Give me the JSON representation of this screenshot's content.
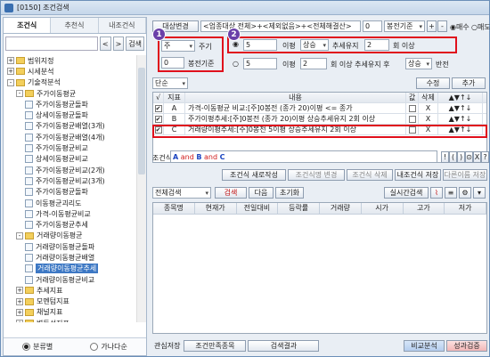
{
  "window": {
    "title": "[0150] 조건검색"
  },
  "left": {
    "tabs": [
      "조건식",
      "추천식",
      "내조건식"
    ],
    "search_btn": "검색",
    "tree": [
      {
        "label": "범위지정",
        "level": 0,
        "type": "folder",
        "exp": "+"
      },
      {
        "label": "시세분석",
        "level": 0,
        "type": "folder",
        "exp": "+"
      },
      {
        "label": "기술적분석",
        "level": 0,
        "type": "folder",
        "exp": "-"
      },
      {
        "label": "주가이동평균",
        "level": 1,
        "type": "folder",
        "exp": "-"
      },
      {
        "label": "주가이동평균돌파",
        "level": 2,
        "type": "leaf"
      },
      {
        "label": "상세이동평균돌파",
        "level": 2,
        "type": "leaf"
      },
      {
        "label": "주가이동평균배열(3개)",
        "level": 2,
        "type": "leaf"
      },
      {
        "label": "주가이동평균배열(4개)",
        "level": 2,
        "type": "leaf"
      },
      {
        "label": "주가이동평균비교",
        "level": 2,
        "type": "leaf"
      },
      {
        "label": "상세이동평균비교",
        "level": 2,
        "type": "leaf"
      },
      {
        "label": "주가이동평균비교(2개)",
        "level": 2,
        "type": "leaf"
      },
      {
        "label": "주가이동평균비교(3개)",
        "level": 2,
        "type": "leaf"
      },
      {
        "label": "주가이동평균돌파",
        "level": 2,
        "type": "leaf"
      },
      {
        "label": "이동평균괴리도",
        "level": 2,
        "type": "leaf"
      },
      {
        "label": "가격-이동평균비교",
        "level": 2,
        "type": "leaf"
      },
      {
        "label": "주가이동평균추세",
        "level": 2,
        "type": "leaf"
      },
      {
        "label": "거래량이동평균",
        "level": 1,
        "type": "folder",
        "exp": "-"
      },
      {
        "label": "거래량이동평균돌파",
        "level": 2,
        "type": "leaf"
      },
      {
        "label": "거래량이동평균배열",
        "level": 2,
        "type": "leaf"
      },
      {
        "label": "거래량이동평균추세",
        "level": 2,
        "type": "leaf",
        "selected": true
      },
      {
        "label": "거래량이동평균비교",
        "level": 2,
        "type": "leaf"
      },
      {
        "label": "추세지표",
        "level": 1,
        "type": "folder",
        "exp": "+"
      },
      {
        "label": "모멘텀지표",
        "level": 1,
        "type": "folder",
        "exp": "+"
      },
      {
        "label": "채널지표",
        "level": 1,
        "type": "folder",
        "exp": "+"
      },
      {
        "label": "변동성지표",
        "level": 1,
        "type": "folder",
        "exp": "+"
      },
      {
        "label": "기타지표",
        "level": 1,
        "type": "folder",
        "exp": "+"
      }
    ],
    "radio_a": "분류별",
    "radio_b": "가나다순"
  },
  "top": {
    "target": "대상변경",
    "scope": "<업종대상 전체>+<제외없음>+<전체해결산>",
    "bong": "0",
    "bong_label": "봉전기준",
    "buy": "매수",
    "sell": "매도"
  },
  "opt1": {
    "period": "주",
    "period_label": "주기",
    "bong": "0",
    "bong_label": "봉전기준"
  },
  "opt2": {
    "days": "5",
    "l1": "이평",
    "dir": "상승",
    "l2": "추세유지",
    "cnt": "2",
    "l3": "회 이상"
  },
  "opt3": {
    "days": "5",
    "l1": "이평",
    "n2": "2",
    "l2": "회 이상 추세유지 후",
    "dir": "상승",
    "l3": "반전"
  },
  "simple": "단순",
  "edit": "수정",
  "add": "추가",
  "grid": {
    "headers": [
      "√",
      "지표",
      "내용",
      "값",
      "삭제",
      "▲▼↑↓"
    ],
    "rows": [
      {
        "k": "A",
        "text": "가격-이동평균 비교:[주]0봉전 (종가 20)이평 <= 종가",
        "del": "X"
      },
      {
        "k": "B",
        "text": "주가이평추세:[주]0봉전 (종가 20)이평 상승추세유지 2회 이상",
        "del": "X"
      },
      {
        "k": "C",
        "text": "거래량이평추세:[주]0봉전 5이평 상승추세유지 2회 이상",
        "del": "X"
      }
    ]
  },
  "cond": {
    "label": "조건식",
    "expr_a": "A",
    "and1": "and",
    "expr_b": "B",
    "and2": "and",
    "expr_c": "C",
    "ops": [
      "!",
      "(",
      ")",
      "⊙",
      "X",
      "?"
    ]
  },
  "actions": {
    "a": "조건식 새로작성",
    "b": "조건식명 변경",
    "c": "조건식 삭제",
    "d": "내조건식 저장",
    "e": "다른이름 저장"
  },
  "search": {
    "scope": "전체검색",
    "btn": "검색",
    "next": "다음",
    "reset": "초기화",
    "realtime": "실시간검색"
  },
  "results": {
    "headers": [
      "종목명",
      "현재가",
      "전일대비",
      "등락률",
      "거래량",
      "시가",
      "고가",
      "저가"
    ]
  },
  "bottom": {
    "label": "관심저장",
    "b1": "조건만족종목",
    "b2": "검색결과",
    "cmp": "비교분석",
    "perf": "성과검증"
  },
  "badges": [
    "1",
    "2"
  ]
}
